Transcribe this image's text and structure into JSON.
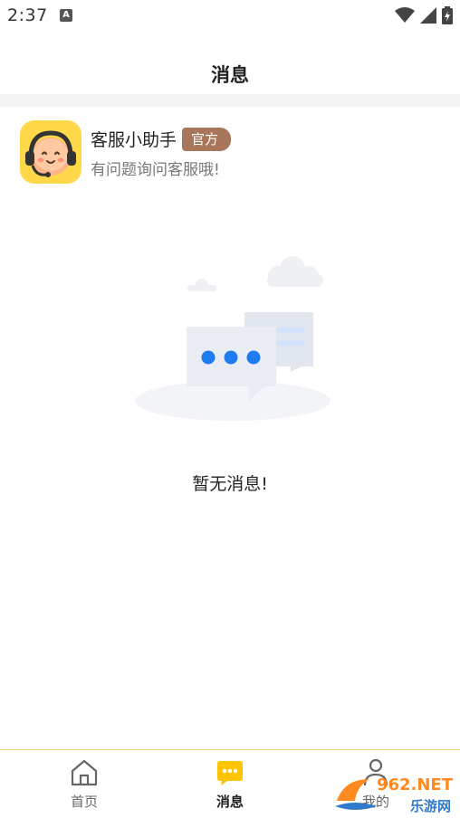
{
  "status_bar": {
    "time": "2:37",
    "notification_glyph": "A"
  },
  "header": {
    "title": "消息"
  },
  "service": {
    "name": "客服小助手",
    "badge": "官方",
    "description": "有问题询问客服哦!"
  },
  "empty_state": {
    "text": "暂无消息!"
  },
  "bottom_nav": {
    "items": [
      {
        "label": "首页",
        "icon": "home-icon",
        "active": false
      },
      {
        "label": "消息",
        "icon": "message-icon",
        "active": true
      },
      {
        "label": "我的",
        "icon": "profile-icon",
        "active": false
      }
    ]
  },
  "watermark": {
    "text": "962.NET",
    "subtext": "乐游网"
  },
  "colors": {
    "accent": "#ffc400",
    "badge": "#a8765a",
    "avatar_bg": "#ffd84a",
    "dots": "#1e7bf0"
  }
}
